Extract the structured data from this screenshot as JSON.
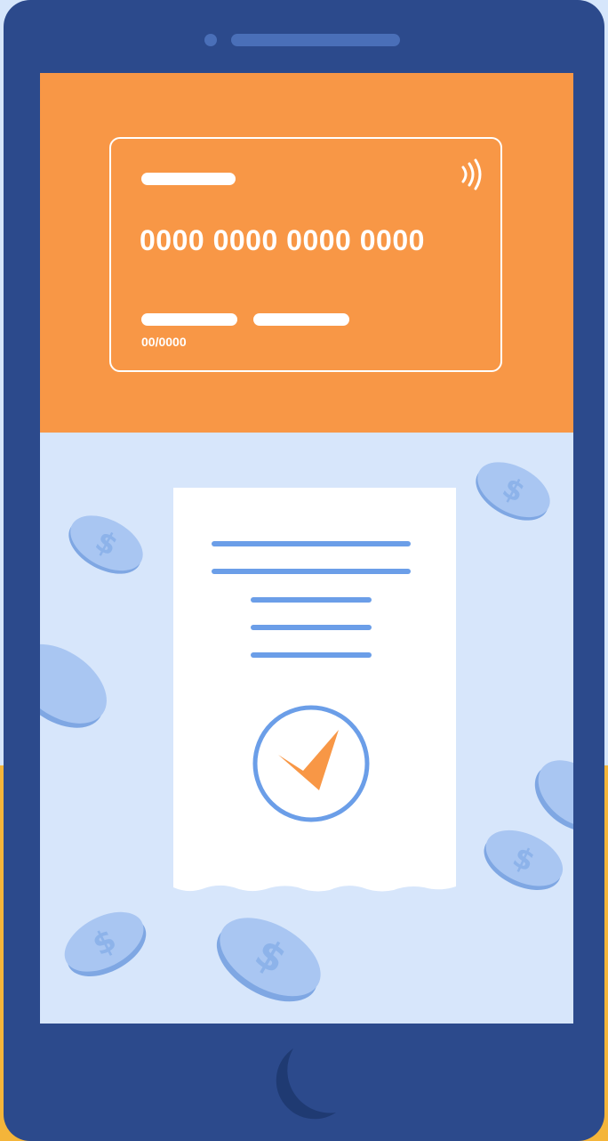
{
  "card": {
    "number": "0000 0000 0000 0000",
    "expiry": "00/0000"
  },
  "colors": {
    "phone_body": "#2c4a8c",
    "screen_bg": "#d7e6fb",
    "card_area": "#f89746",
    "accent_blue": "#6b9ee8",
    "check_orange": "#f89746"
  },
  "icons": [
    "contactless-icon",
    "checkmark-icon",
    "dollar-coin-icon",
    "home-button-icon"
  ]
}
